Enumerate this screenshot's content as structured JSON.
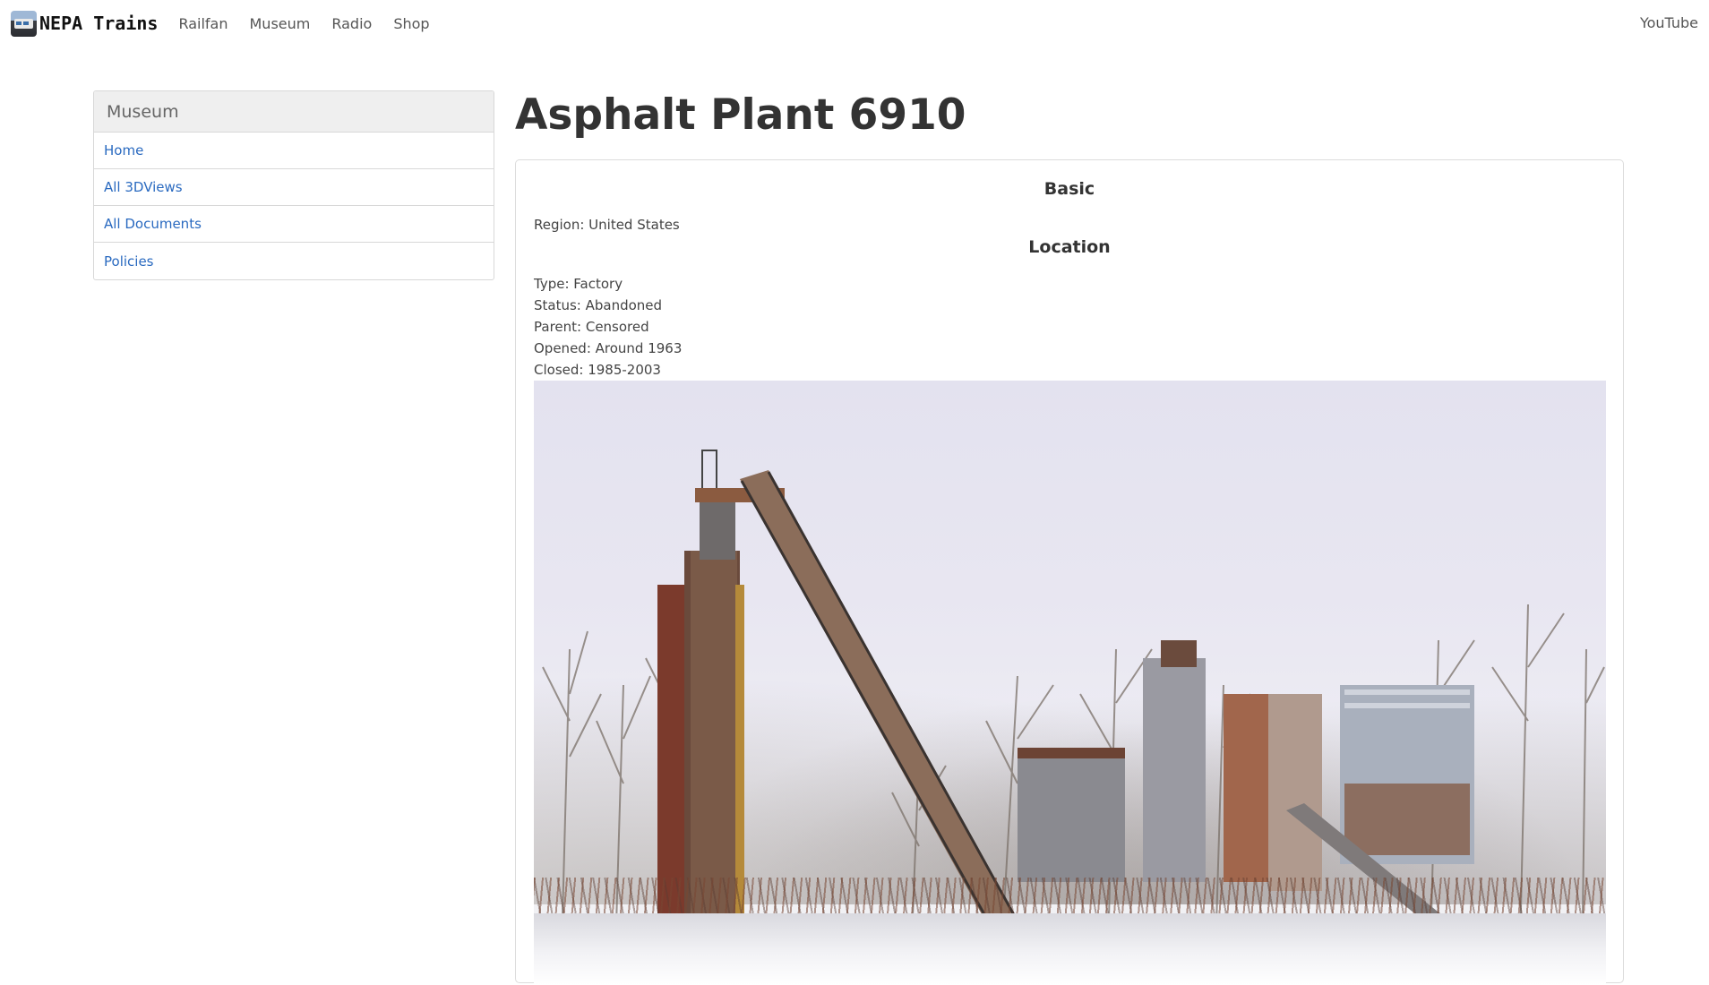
{
  "nav": {
    "brand": "NEPA Trains",
    "links": [
      "Railfan",
      "Museum",
      "Radio",
      "Shop"
    ],
    "right_link": "YouTube"
  },
  "sidebar": {
    "heading": "Museum",
    "items": [
      {
        "label": "Home"
      },
      {
        "label": "All 3DViews"
      },
      {
        "label": "All Documents"
      },
      {
        "label": "Policies"
      }
    ]
  },
  "page": {
    "title": "Asphalt Plant 6910"
  },
  "card": {
    "basic_title": "Basic",
    "region": "Region: United States",
    "location_title": "Location",
    "type": "Type: Factory",
    "status": "Status: Abandoned",
    "parent": "Parent: Censored",
    "opened": "Opened: Around 1963",
    "closed": "Closed: 1985-2003"
  },
  "colors": {
    "link": "#2a6ac0",
    "sidebar_heading_bg": "#efefef",
    "border": "#d8d8d8"
  }
}
